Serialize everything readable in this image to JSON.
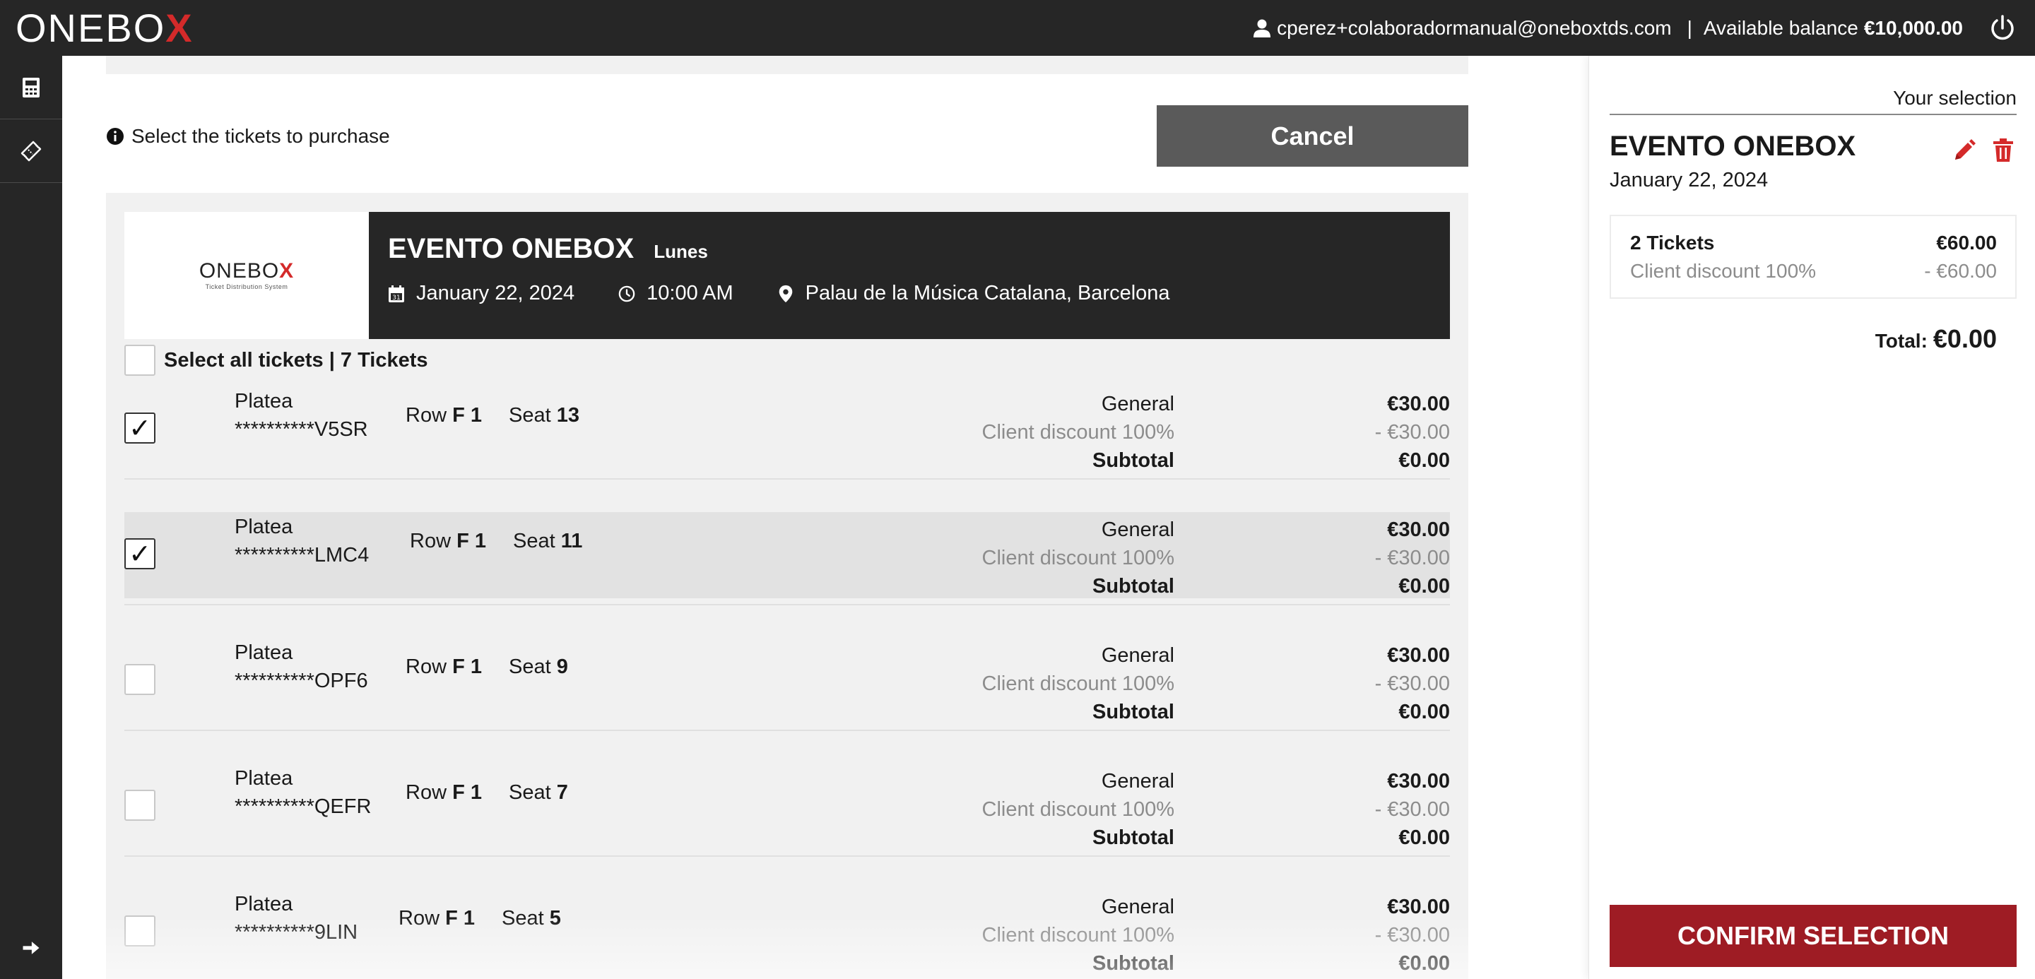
{
  "header": {
    "logo_main": "ONEBO",
    "logo_x": "X",
    "user_email": "cperez+colaboradormanual@oneboxtds.com",
    "separator": "|",
    "balance_label": "Available balance",
    "balance_amount": "€10,000.00"
  },
  "main": {
    "hint": "Select the tickets to purchase",
    "cancel_label": "Cancel",
    "event": {
      "logo_main": "ONEBO",
      "logo_x": "X",
      "logo_sub": "Ticket Distribution System",
      "title": "EVENTO ONEBOX",
      "day": "Lunes",
      "date": "January 22, 2024",
      "time": "10:00 AM",
      "venue": "Palau de la Música Catalana, Barcelona"
    },
    "select_all_label": "Select all tickets | 7 Tickets",
    "tickets": [
      {
        "zone": "Platea",
        "code": "**********V5SR",
        "row_label": "Row",
        "row": "F 1",
        "seat_label": "Seat",
        "seat": "13",
        "price_type": "General",
        "price": "€30.00",
        "discount_label": "Client discount 100%",
        "discount": "- €30.00",
        "subtotal_label": "Subtotal",
        "subtotal": "€0.00",
        "checked": "✓"
      },
      {
        "zone": "Platea",
        "code": "**********LMC4",
        "row_label": "Row",
        "row": "F 1",
        "seat_label": "Seat",
        "seat": "11",
        "price_type": "General",
        "price": "€30.00",
        "discount_label": "Client discount 100%",
        "discount": "- €30.00",
        "subtotal_label": "Subtotal",
        "subtotal": "€0.00",
        "checked": "✓"
      },
      {
        "zone": "Platea",
        "code": "**********OPF6",
        "row_label": "Row",
        "row": "F 1",
        "seat_label": "Seat",
        "seat": "9",
        "price_type": "General",
        "price": "€30.00",
        "discount_label": "Client discount 100%",
        "discount": "- €30.00",
        "subtotal_label": "Subtotal",
        "subtotal": "€0.00",
        "checked": ""
      },
      {
        "zone": "Platea",
        "code": "**********QEFR",
        "row_label": "Row",
        "row": "F 1",
        "seat_label": "Seat",
        "seat": "7",
        "price_type": "General",
        "price": "€30.00",
        "discount_label": "Client discount 100%",
        "discount": "- €30.00",
        "subtotal_label": "Subtotal",
        "subtotal": "€0.00",
        "checked": ""
      },
      {
        "zone": "Platea",
        "code": "**********9LIN",
        "row_label": "Row",
        "row": "F 1",
        "seat_label": "Seat",
        "seat": "5",
        "price_type": "General",
        "price": "€30.00",
        "discount_label": "Client discount 100%",
        "discount": "- €30.00",
        "subtotal_label": "Subtotal",
        "subtotal": "€0.00",
        "checked": ""
      }
    ]
  },
  "selection": {
    "heading": "Your selection",
    "event_title": "EVENTO ONEBOX",
    "event_date": "January 22, 2024",
    "tickets_label": "2 Tickets",
    "tickets_amount": "€60.00",
    "discount_label": "Client discount 100%",
    "discount_amount": "- €60.00",
    "total_label": "Total:",
    "total_amount": "€0.00",
    "confirm_label": "CONFIRM SELECTION"
  },
  "colors": {
    "dark_bar": "#262626",
    "brand_red": "#d42a2a",
    "confirm_red": "#9e1c24",
    "cancel_gray": "#5a5a5a",
    "panel_bg": "#f1f1f1"
  },
  "icons": {
    "user": "user-icon",
    "power": "power-icon",
    "calculator": "calculator-icon",
    "ticket": "ticket-icon",
    "expand": "arrow-right-icon",
    "info": "info-icon",
    "calendar": "calendar-icon",
    "clock": "clock-icon",
    "location": "location-pin-icon",
    "edit": "pencil-icon",
    "delete": "trash-icon"
  }
}
